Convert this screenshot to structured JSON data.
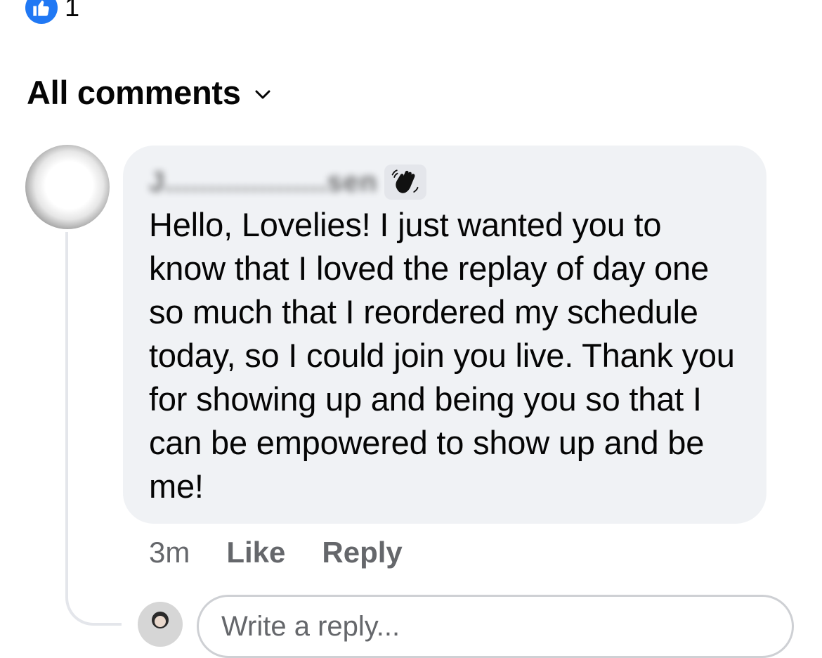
{
  "reactions": {
    "icon": "like-thumbs-up-icon",
    "count": "1",
    "badge_color": "#2078f4"
  },
  "comments_header": {
    "sort_label": "All comments",
    "chevron_icon": "chevron-down-icon"
  },
  "comment": {
    "author_name": "J...................sen",
    "author_badge_icon": "waving-hand-icon",
    "text": "Hello, Lovelies! I just wanted you to know that I loved the replay of day one so much that I reordered my schedule today, so I could join you live. Thank you for showing up and being you so that I can be empowered to show up and be me!",
    "timestamp": "3m",
    "like_label": "Like",
    "reply_label": "Reply"
  },
  "composer": {
    "placeholder": "Write a reply..."
  },
  "colors": {
    "bubble_bg": "#f0f2f5",
    "secondary_text": "#65676b",
    "primary_text": "#050505",
    "thread_line": "#e4e6eb"
  }
}
